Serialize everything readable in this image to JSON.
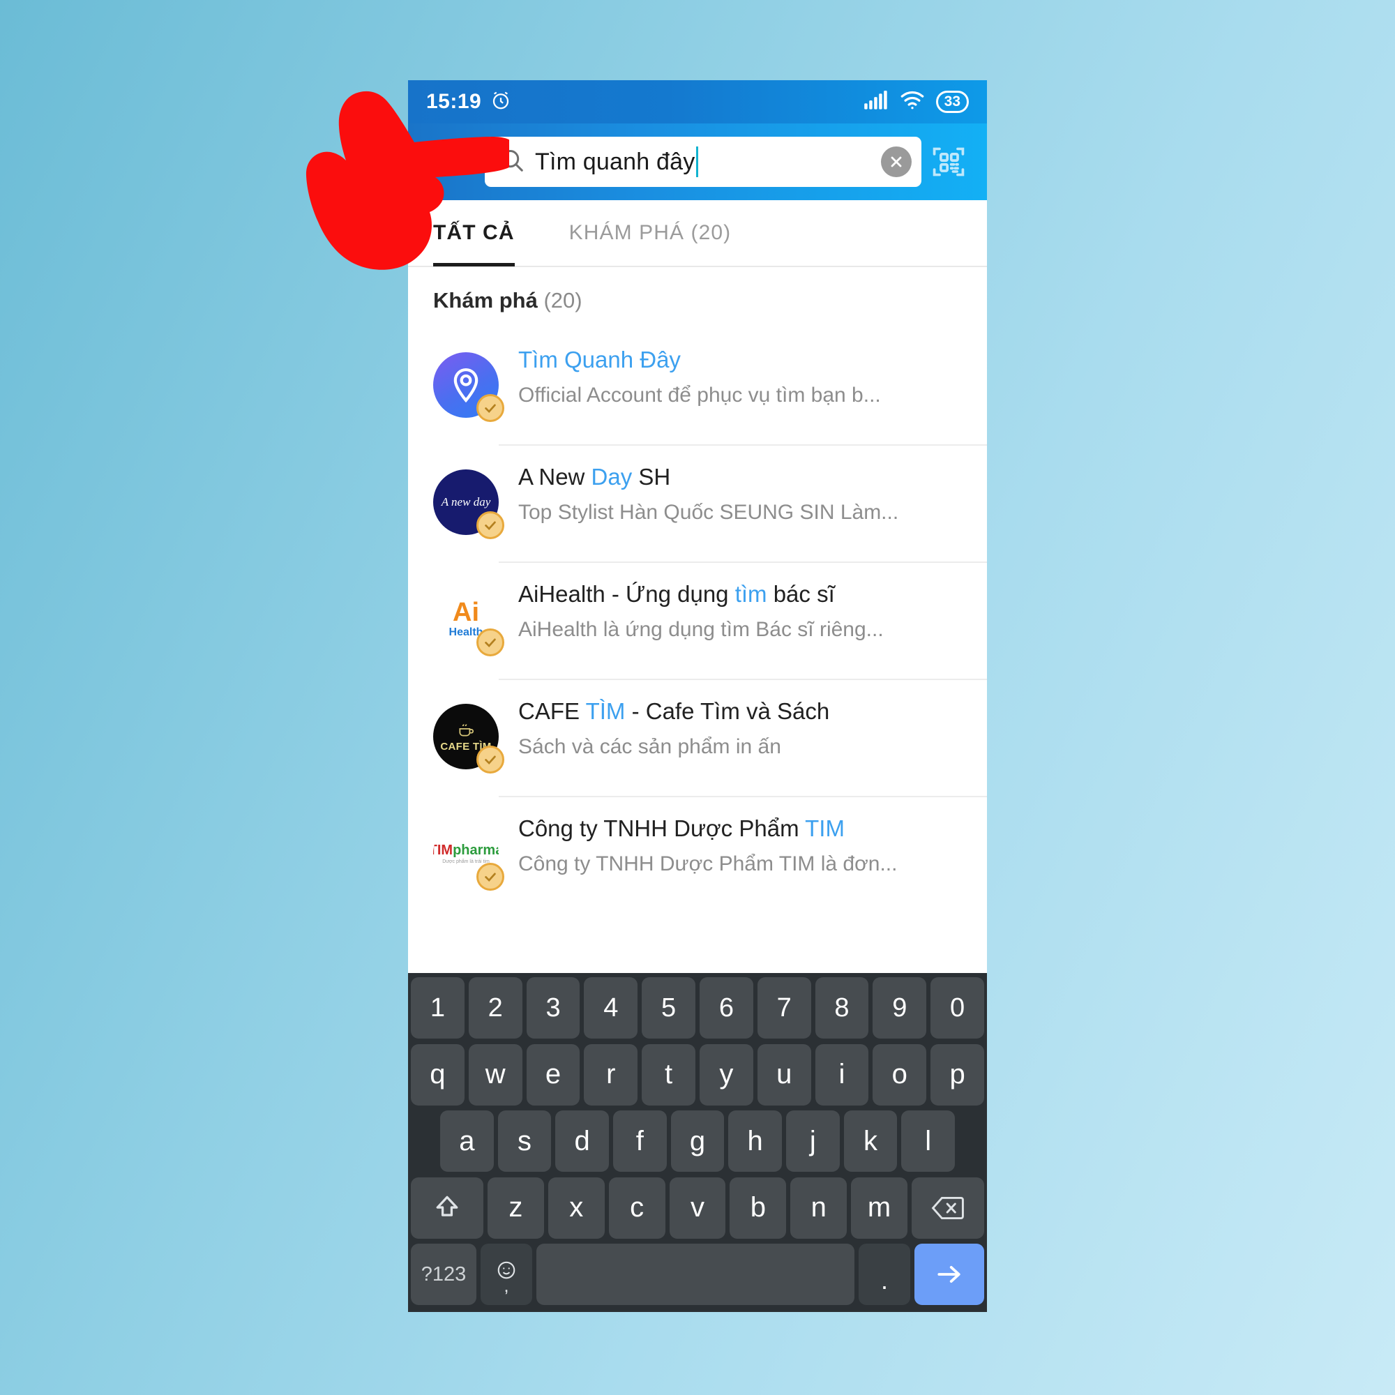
{
  "status_bar": {
    "time": "15:19",
    "alarm_icon": "alarm-clock-icon",
    "signal_icon": "cellular-signal-icon",
    "wifi_icon": "wifi-icon",
    "battery_level": "33"
  },
  "search": {
    "value": "Tìm quanh đây",
    "search_icon": "search-icon",
    "clear_icon": "clear-circle-icon",
    "qr_icon": "qr-scan-icon"
  },
  "tabs": [
    {
      "label": "TẤT CẢ",
      "active": true
    },
    {
      "label": "KHÁM PHÁ (20)",
      "active": false
    }
  ],
  "section": {
    "title": "Khám phá",
    "count": "(20)"
  },
  "results": [
    {
      "title_pre": "",
      "title_hl": "Tìm Quanh Đây",
      "title_post": "",
      "title_all_highlight": true,
      "subtitle": "Official Account để phục vụ tìm bạn b...",
      "avatar_name": "tim-quanh-day-logo",
      "avatar_text": "",
      "verified": true
    },
    {
      "title_pre": "A New ",
      "title_hl": "Day",
      "title_post": " SH",
      "title_all_highlight": false,
      "subtitle": "Top Stylist Hàn Quốc SEUNG SIN Làm...",
      "avatar_name": "a-new-day-sh-logo",
      "avatar_text": "A new day",
      "verified": true
    },
    {
      "title_pre": "AiHealth - Ứng dụng ",
      "title_hl": "tìm",
      "title_post": " bác sĩ",
      "title_all_highlight": false,
      "subtitle": "AiHealth là ứng dụng tìm Bác sĩ riêng...",
      "avatar_name": "aihealth-logo",
      "avatar_text": "Ai",
      "verified": true
    },
    {
      "title_pre": "CAFE ",
      "title_hl": "TÌM",
      "title_post": " - Cafe Tìm và Sách",
      "title_all_highlight": false,
      "subtitle": "Sách và các sản phẩm in ấn",
      "avatar_name": "cafe-tim-logo",
      "avatar_text": "CAFE TÌM",
      "verified": true
    },
    {
      "title_pre": "Công ty TNHH Dược Phẩm ",
      "title_hl": "TIM",
      "title_post": "",
      "title_all_highlight": false,
      "subtitle": "Công ty TNHH Dược Phẩm TIM là đơn...",
      "avatar_name": "tim-pharma-logo",
      "avatar_text": "TIM",
      "verified": true
    }
  ],
  "keyboard": {
    "row_numbers": [
      "1",
      "2",
      "3",
      "4",
      "5",
      "6",
      "7",
      "8",
      "9",
      "0"
    ],
    "row_top": [
      "q",
      "w",
      "e",
      "r",
      "t",
      "y",
      "u",
      "i",
      "o",
      "p"
    ],
    "row_home": [
      "a",
      "s",
      "d",
      "f",
      "g",
      "h",
      "j",
      "k",
      "l"
    ],
    "row_bottom": [
      "z",
      "x",
      "c",
      "v",
      "b",
      "n",
      "m"
    ],
    "shift_icon": "shift-arrow-icon",
    "backspace_icon": "backspace-icon",
    "symbols_label": "?123",
    "emoji_icon": "emoji-smiley-icon",
    "comma_label": ",",
    "space_label": "",
    "period_label": ".",
    "enter_icon": "enter-arrow-icon"
  },
  "annotation": {
    "pointer": "red-pointing-hand-icon"
  },
  "colors": {
    "accent_blue": "#3ca0ef",
    "status_bar_blue": "#1773c9",
    "search_bar_blue": "#13b0f5",
    "keyboard_bg": "#2b3034",
    "key_bg": "#474c50",
    "enter_key": "#6c9ef8",
    "annotation_red": "#fb0d0d"
  }
}
